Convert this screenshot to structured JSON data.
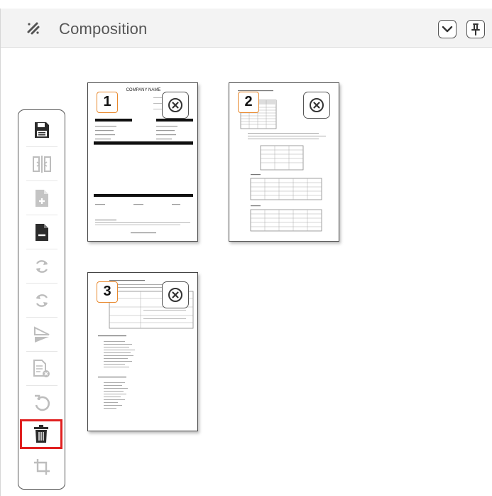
{
  "header": {
    "title": "Composition",
    "icon": "composition-icon",
    "buttons": [
      "collapse-chevron-icon",
      "pin-icon"
    ]
  },
  "toolbar": {
    "tools": [
      {
        "name": "save-icon",
        "enabled": true
      },
      {
        "name": "split-icon",
        "enabled": false
      },
      {
        "name": "add-page-icon",
        "enabled": false
      },
      {
        "name": "remove-page-icon",
        "enabled": true
      },
      {
        "name": "rotate-clockwise-icon",
        "enabled": false
      },
      {
        "name": "rotate-counterclockwise-icon",
        "enabled": false
      },
      {
        "name": "mirror-icon",
        "enabled": false
      },
      {
        "name": "remove-document-icon",
        "enabled": false
      },
      {
        "name": "undo-icon",
        "enabled": false
      },
      {
        "name": "delete-icon",
        "enabled": true,
        "selected": true
      },
      {
        "name": "crop-icon",
        "enabled": false
      }
    ]
  },
  "pages": [
    {
      "number": "1",
      "heading": "COMPANY NAME"
    },
    {
      "number": "2"
    },
    {
      "number": "3"
    }
  ],
  "colors": {
    "accent": "#e8882c",
    "selected_outline": "#e02020",
    "icon": "#555555",
    "disabled_icon": "#bdbdbd"
  }
}
